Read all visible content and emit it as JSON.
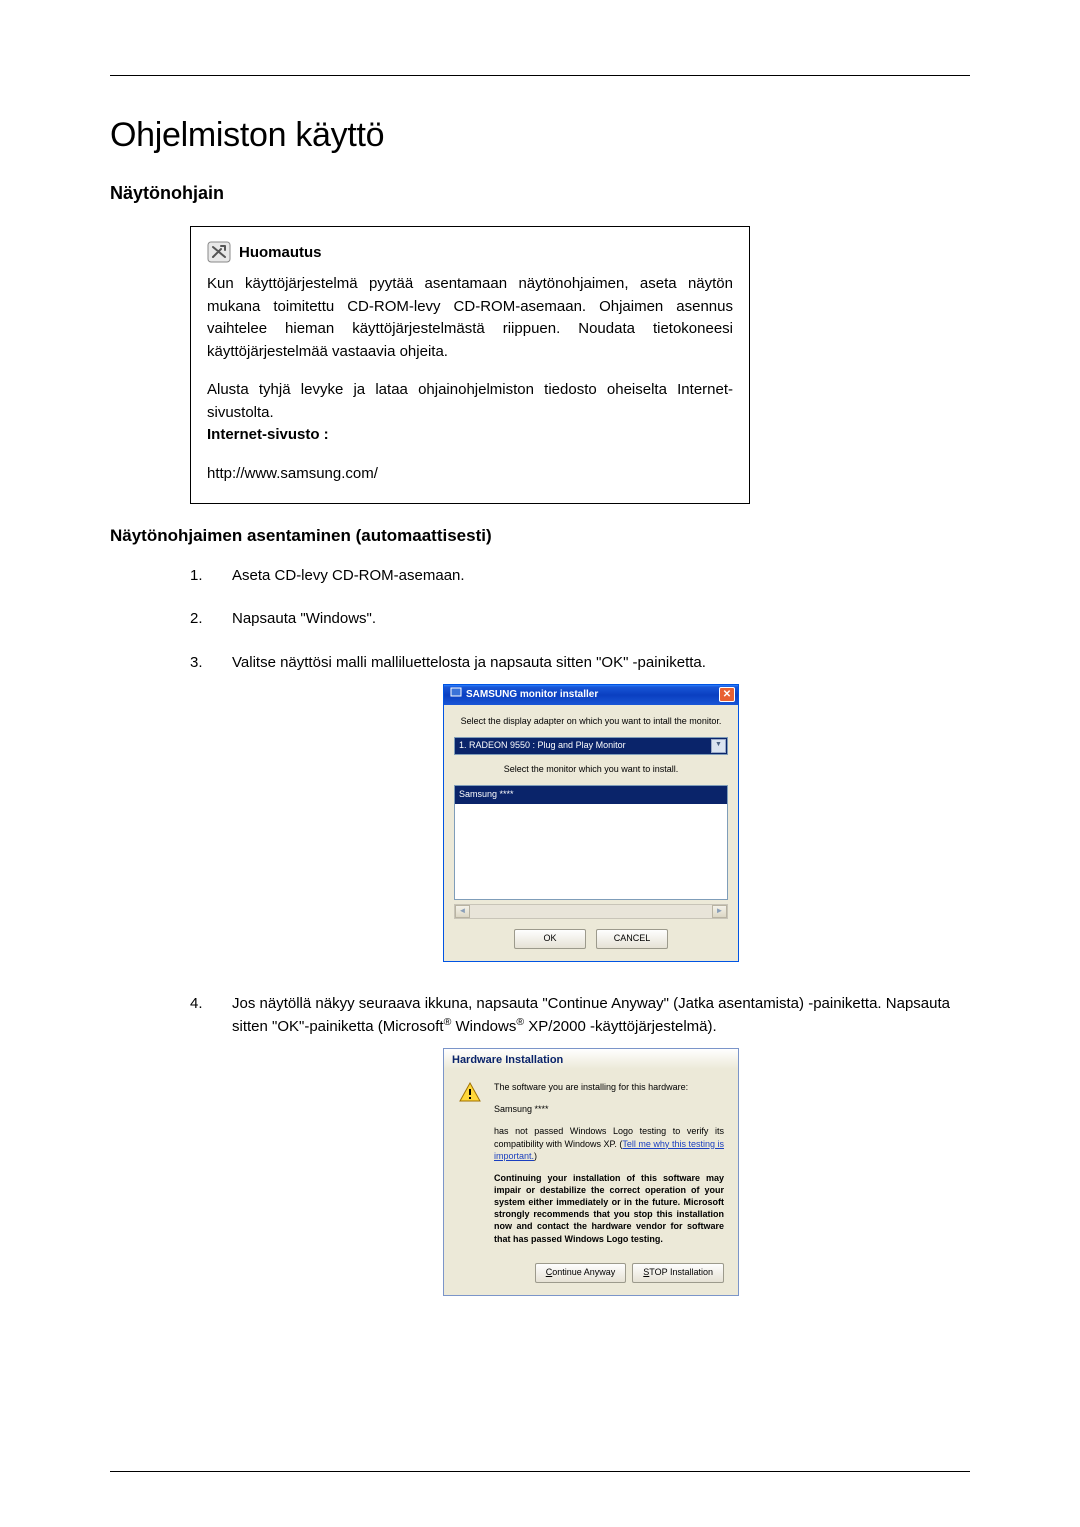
{
  "page": {
    "title": "Ohjelmiston käyttö",
    "section1": "Näytönohjain",
    "subsection": "Näytönohjaimen asentaminen (automaattisesti)"
  },
  "note": {
    "heading": "Huomautus",
    "para1": "Kun käyttöjärjestelmä pyytää asentamaan näytönohjaimen, aseta näytön mukana toimitettu CD-ROM-levy CD-ROM-asemaan. Ohjaimen asennus vaihtelee hieman käyttöjärjestelmästä riippuen. Noudata tietokoneesi käyttöjärjestelmää vastaavia ohjeita.",
    "para2": "Alusta tyhjä levyke ja lataa ohjainohjelmiston tiedosto oheiselta Internet-sivustolta.",
    "label": "Internet-sivusto :",
    "url": "http://www.samsung.com/"
  },
  "steps": {
    "s1": {
      "num": "1.",
      "text": "Aseta CD-levy CD-ROM-asemaan."
    },
    "s2": {
      "num": "2.",
      "text": "Napsauta \"Windows\"."
    },
    "s3": {
      "num": "3.",
      "text": "Valitse näyttösi malli malliluettelosta ja napsauta sitten \"OK\" -painiketta."
    },
    "s4": {
      "num": "4.",
      "pre": "Jos näytöllä näkyy seuraava ikkuna, napsauta \"Continue Anyway\" (Jatka asentamista) -painiketta. Napsauta sitten \"OK\"-painiketta (Microsoft",
      "sup1": "®",
      "mid": " Windows",
      "sup2": "®",
      "post": " XP/2000 -käyttöjärjestelmä)."
    }
  },
  "installer": {
    "title": "SAMSUNG monitor installer",
    "label1": "Select the display adapter on which you want to intall the monitor.",
    "select": "1. RADEON 9550 : Plug and Play Monitor",
    "label2": "Select the monitor which you want to install.",
    "item": "Samsung ****",
    "ok": "OK",
    "cancel": "CANCEL"
  },
  "hw": {
    "title": "Hardware Installation",
    "p1": "The software you are installing for this hardware:",
    "device": "Samsung ****",
    "p2a": "has not passed Windows Logo testing to verify its compatibility with Windows XP. (",
    "link": "Tell me why this testing is important.",
    "p2b": ")",
    "warn": "Continuing your installation of this software may impair or destabilize the correct operation of your system either immediately or in the future. Microsoft strongly recommends that you stop this installation now and contact the hardware vendor for software that has passed Windows Logo testing.",
    "btn_continue": "ontinue Anyway",
    "btn_continue_u": "C",
    "btn_stop": "TOP Installation",
    "btn_stop_u": "S"
  }
}
